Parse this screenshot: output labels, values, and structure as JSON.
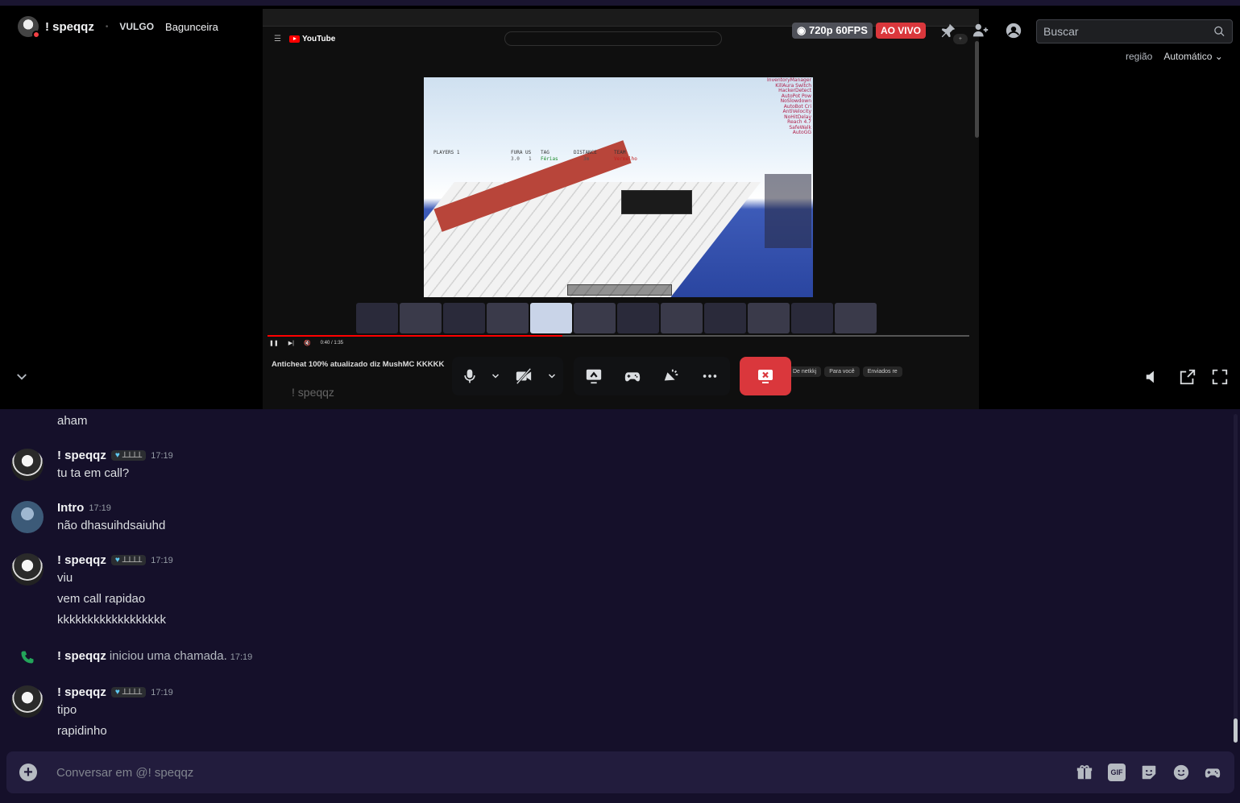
{
  "header": {
    "username": "! speqqz",
    "clan_tag": "VULGO",
    "server_name": "Bagunceira",
    "quality": "720p 60FPS",
    "live_label": "AO VIVO",
    "search_placeholder": "Buscar",
    "region_label": "região",
    "region_value": "Automático"
  },
  "stream": {
    "youtube_logo": "YouTube",
    "video_title": "Anticheat 100% atualizado diz MushMC KKKKK",
    "overlay_name": "! speqqz",
    "video_time": "0:40 / 1:35",
    "chips": [
      "De netkkj",
      "Para você",
      "Enviados re"
    ],
    "cheat_list": [
      "InventoryManager",
      "KillAura Switch",
      "HackerDetect",
      "AutoPot Pow",
      "NoSlowdown",
      "AutoBot Cri",
      "AntiVelocity",
      "NoHitDelay",
      "Reach 4.7",
      "SafeWalk",
      "AutoGG"
    ],
    "hud": {
      "players": "PLAYERS 1",
      "fura": "FURA US",
      "tag": "TAG",
      "distance": "DISTANCE",
      "team": "TEAM",
      "team_value": "Vermelho",
      "tag_value": "Férias",
      "count": "3.0",
      "ping": "1",
      "dist_value": "3m"
    },
    "progress": 0.42
  },
  "messages": [
    {
      "type": "continuation",
      "text": "aham"
    },
    {
      "type": "full",
      "author": "! speqqz",
      "time": "17:19",
      "badge": true,
      "lines": [
        "tu ta em call?"
      ]
    },
    {
      "type": "full",
      "author": "Intro",
      "time": "17:19",
      "badge": false,
      "lines": [
        "não dhasuihdsaiuhd"
      ]
    },
    {
      "type": "full",
      "author": "! speqqz",
      "time": "17:19",
      "badge": true,
      "lines": [
        "viu",
        "vem call rapidao",
        "kkkkkkkkkkkkkkkkkk"
      ]
    },
    {
      "type": "system",
      "author": "! speqqz",
      "text": "iniciou uma chamada.",
      "time": "17:19"
    },
    {
      "type": "full",
      "author": "! speqqz",
      "time": "17:19",
      "badge": true,
      "lines": [
        "tipo",
        "rapidinho"
      ]
    }
  ],
  "badge_text": "ꓕꓕꓕꓕ",
  "composer": {
    "placeholder": "Conversar em @! speqqz",
    "gif_label": "GIF"
  },
  "colors": {
    "end_call": "#da373c",
    "live": "#da373c",
    "chat_bg": "#15102a",
    "phone_green": "#23a55a"
  }
}
